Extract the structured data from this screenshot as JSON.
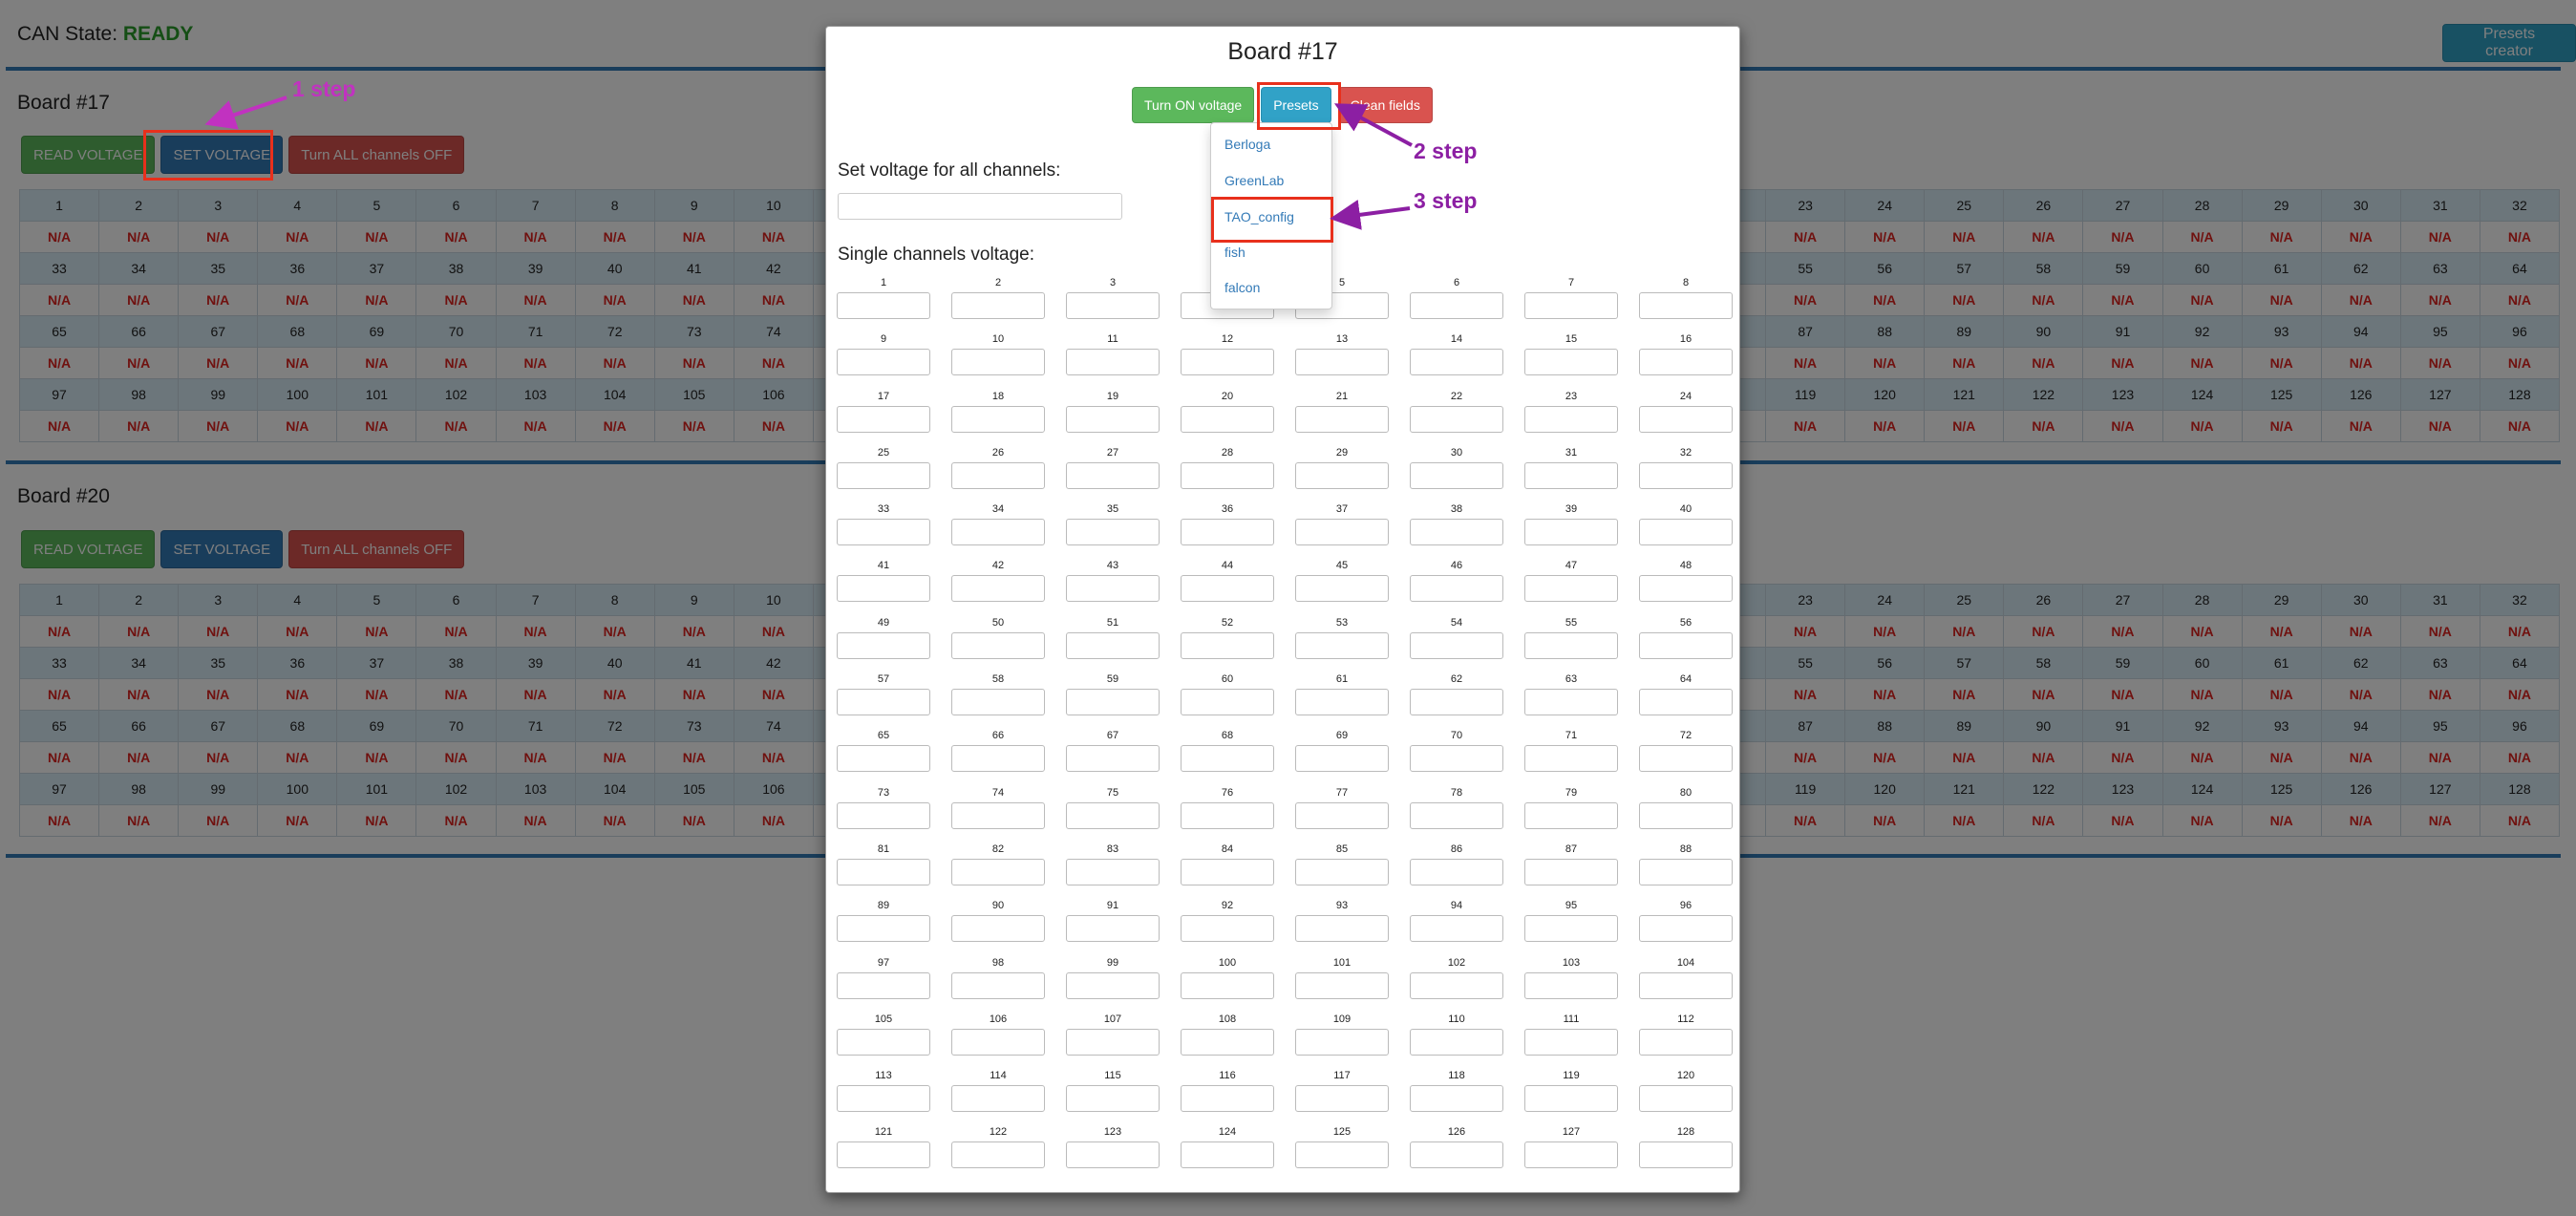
{
  "header": {
    "can_state_label": "CAN State:",
    "can_state_value": "READY",
    "presets_creator": "Presets creator"
  },
  "boards": [
    {
      "title": "Board #17",
      "buttons": {
        "read": "READ VOLTAGE",
        "set": "SET VOLTAGE",
        "off": "Turn ALL channels OFF"
      },
      "value_placeholder": "N/A"
    },
    {
      "title": "Board #20",
      "buttons": {
        "read": "READ VOLTAGE",
        "set": "SET VOLTAGE",
        "off": "Turn ALL channels OFF"
      },
      "value_placeholder": "N/A"
    }
  ],
  "table": {
    "total_channels": 128,
    "columns_per_row": 32
  },
  "modal": {
    "title": "Board #17",
    "turn_on": "Turn ON voltage",
    "presets": "Presets",
    "clean": "Clean fields",
    "all_label": "Set voltage for all channels:",
    "single_label": "Single channels voltage:",
    "channel_count": 128
  },
  "presets_menu": [
    "Berloga",
    "GreenLab",
    "TAO_config",
    "fish",
    "falcon"
  ],
  "annotations": {
    "step1": "1 step",
    "step2": "2 step",
    "step3": "3 step"
  },
  "colors": {
    "na_red": "#e0231f",
    "ready_green": "#2a9d2a",
    "step1": "#c132c0",
    "step23": "#8c1fa3",
    "highlight": "#e8301c"
  }
}
